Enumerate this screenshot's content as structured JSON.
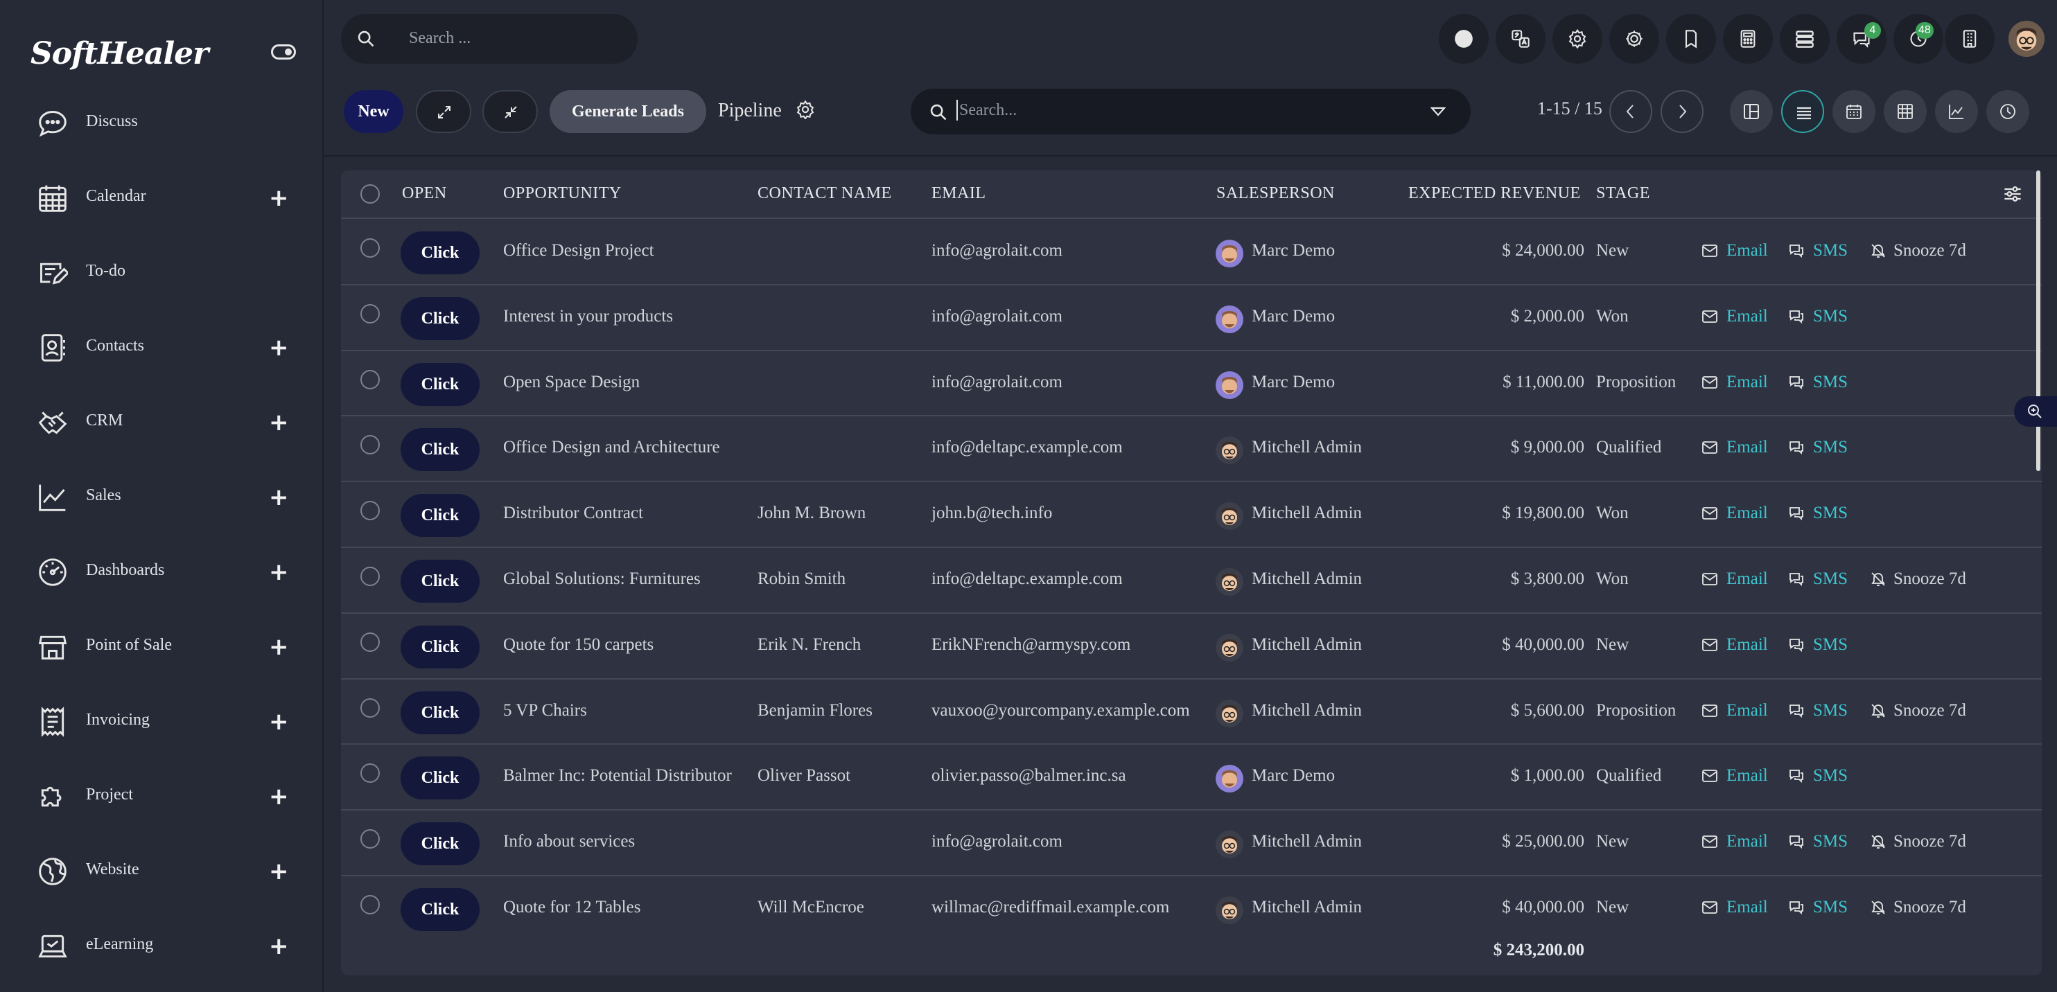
{
  "app": {
    "logo": "SoftHealer"
  },
  "sidebar": {
    "items": [
      {
        "label": "Discuss",
        "icon": "chat-bubble-icon",
        "has_plus": false
      },
      {
        "label": "Calendar",
        "icon": "calendar-icon",
        "has_plus": true
      },
      {
        "label": "To-do",
        "icon": "todo-icon",
        "has_plus": false
      },
      {
        "label": "Contacts",
        "icon": "contacts-icon",
        "has_plus": true
      },
      {
        "label": "CRM",
        "icon": "handshake-icon",
        "has_plus": true
      },
      {
        "label": "Sales",
        "icon": "chart-line-icon",
        "has_plus": true
      },
      {
        "label": "Dashboards",
        "icon": "gauge-icon",
        "has_plus": true
      },
      {
        "label": "Point of Sale",
        "icon": "store-icon",
        "has_plus": true
      },
      {
        "label": "Invoicing",
        "icon": "invoice-icon",
        "has_plus": true
      },
      {
        "label": "Project",
        "icon": "puzzle-icon",
        "has_plus": true
      },
      {
        "label": "Website",
        "icon": "globe-icon",
        "has_plus": true
      },
      {
        "label": "eLearning",
        "icon": "laptop-icon",
        "has_plus": true
      }
    ],
    "plus_symbol": "+"
  },
  "topbar": {
    "search_placeholder": "Search ...",
    "icons": [
      "record-icon",
      "translate-icon",
      "settings-gear-icon",
      "cog-icon",
      "bookmark-icon",
      "calculator-icon",
      "list-settings-icon",
      "messages-icon",
      "activity-clock-icon",
      "building-icon"
    ],
    "messages_badge": "4",
    "activity_badge": "48"
  },
  "control": {
    "new_label": "New",
    "generate_label": "Generate Leads",
    "pipeline_label": "Pipeline",
    "search_placeholder": "Search...",
    "pager": "1-15 / 15",
    "views": [
      "kanban-view-icon",
      "list-view-icon",
      "calendar-view-icon",
      "pivot-view-icon",
      "graph-view-icon",
      "activity-view-icon"
    ]
  },
  "table": {
    "headers": {
      "open": "OPEN",
      "opportunity": "OPPORTUNITY",
      "contact": "CONTACT NAME",
      "email": "EMAIL",
      "salesperson": "SALESPERSON",
      "revenue": "EXPECTED REVENUE",
      "stage": "STAGE"
    },
    "click_label": "Click",
    "email_action": "Email",
    "sms_action": "SMS",
    "snooze_action": "Snooze 7d",
    "rows": [
      {
        "opportunity": "Office Design Project",
        "contact": "",
        "email": "info@agrolait.com",
        "salesperson": "Marc Demo",
        "revenue": "$ 24,000.00",
        "stage": "New",
        "snooze": true
      },
      {
        "opportunity": "Interest in your products",
        "contact": "",
        "email": "info@agrolait.com",
        "salesperson": "Marc Demo",
        "revenue": "$ 2,000.00",
        "stage": "Won",
        "snooze": false
      },
      {
        "opportunity": "Open Space Design",
        "contact": "",
        "email": "info@agrolait.com",
        "salesperson": "Marc Demo",
        "revenue": "$ 11,000.00",
        "stage": "Proposition",
        "snooze": false
      },
      {
        "opportunity": "Office Design and Architecture",
        "contact": "",
        "email": "info@deltapc.example.com",
        "salesperson": "Mitchell Admin",
        "revenue": "$ 9,000.00",
        "stage": "Qualified",
        "snooze": false
      },
      {
        "opportunity": "Distributor Contract",
        "contact": "John M. Brown",
        "email": "john.b@tech.info",
        "salesperson": "Mitchell Admin",
        "revenue": "$ 19,800.00",
        "stage": "Won",
        "snooze": false
      },
      {
        "opportunity": "Global Solutions: Furnitures",
        "contact": "Robin Smith",
        "email": "info@deltapc.example.com",
        "salesperson": "Mitchell Admin",
        "revenue": "$ 3,800.00",
        "stage": "Won",
        "snooze": true
      },
      {
        "opportunity": "Quote for 150 carpets",
        "contact": "Erik N. French",
        "email": "ErikNFrench@armyspy.com",
        "salesperson": "Mitchell Admin",
        "revenue": "$ 40,000.00",
        "stage": "New",
        "snooze": false
      },
      {
        "opportunity": "5 VP Chairs",
        "contact": "Benjamin Flores",
        "email": "vauxoo@yourcompany.example.com",
        "salesperson": "Mitchell Admin",
        "revenue": "$ 5,600.00",
        "stage": "Proposition",
        "snooze": true
      },
      {
        "opportunity": "Balmer Inc: Potential Distributor",
        "contact": "Oliver Passot",
        "email": "olivier.passo@balmer.inc.sa",
        "salesperson": "Marc Demo",
        "revenue": "$ 1,000.00",
        "stage": "Qualified",
        "snooze": false
      },
      {
        "opportunity": "Info about services",
        "contact": "",
        "email": "info@agrolait.com",
        "salesperson": "Mitchell Admin",
        "revenue": "$ 25,000.00",
        "stage": "New",
        "snooze": true
      },
      {
        "opportunity": "Quote for 12 Tables",
        "contact": "Will McEncroe",
        "email": "willmac@rediffmail.example.com",
        "salesperson": "Mitchell Admin",
        "revenue": "$ 40,000.00",
        "stage": "New",
        "snooze": true
      }
    ],
    "total": "$ 243,200.00"
  },
  "colors": {
    "accent_link": "#3ec6d0",
    "primary_button": "#14193c",
    "badge": "#3fa45a"
  }
}
